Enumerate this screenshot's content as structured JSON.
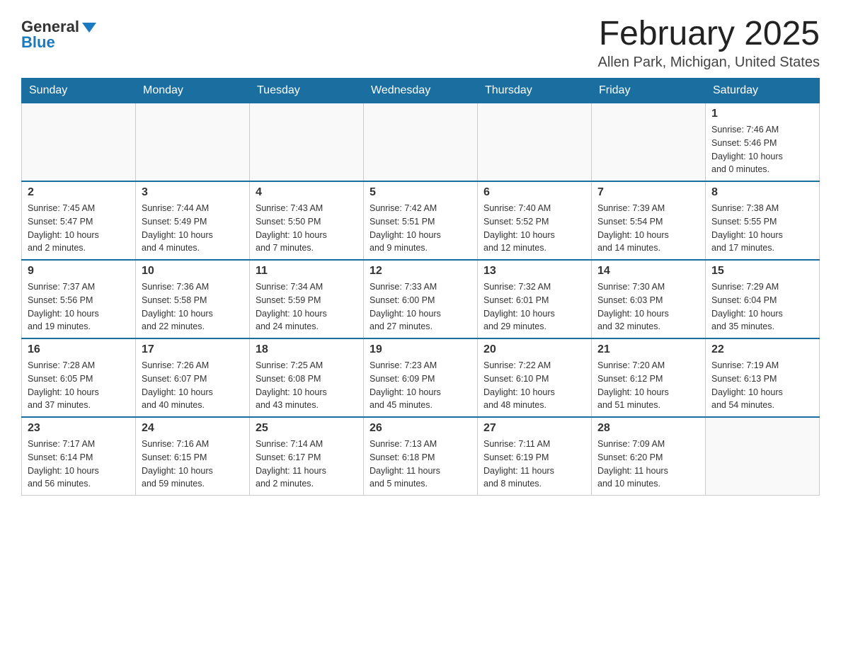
{
  "logo": {
    "general": "General",
    "blue": "Blue"
  },
  "title": "February 2025",
  "location": "Allen Park, Michigan, United States",
  "days_of_week": [
    "Sunday",
    "Monday",
    "Tuesday",
    "Wednesday",
    "Thursday",
    "Friday",
    "Saturday"
  ],
  "weeks": [
    [
      {
        "day": "",
        "info": ""
      },
      {
        "day": "",
        "info": ""
      },
      {
        "day": "",
        "info": ""
      },
      {
        "day": "",
        "info": ""
      },
      {
        "day": "",
        "info": ""
      },
      {
        "day": "",
        "info": ""
      },
      {
        "day": "1",
        "info": "Sunrise: 7:46 AM\nSunset: 5:46 PM\nDaylight: 10 hours\nand 0 minutes."
      }
    ],
    [
      {
        "day": "2",
        "info": "Sunrise: 7:45 AM\nSunset: 5:47 PM\nDaylight: 10 hours\nand 2 minutes."
      },
      {
        "day": "3",
        "info": "Sunrise: 7:44 AM\nSunset: 5:49 PM\nDaylight: 10 hours\nand 4 minutes."
      },
      {
        "day": "4",
        "info": "Sunrise: 7:43 AM\nSunset: 5:50 PM\nDaylight: 10 hours\nand 7 minutes."
      },
      {
        "day": "5",
        "info": "Sunrise: 7:42 AM\nSunset: 5:51 PM\nDaylight: 10 hours\nand 9 minutes."
      },
      {
        "day": "6",
        "info": "Sunrise: 7:40 AM\nSunset: 5:52 PM\nDaylight: 10 hours\nand 12 minutes."
      },
      {
        "day": "7",
        "info": "Sunrise: 7:39 AM\nSunset: 5:54 PM\nDaylight: 10 hours\nand 14 minutes."
      },
      {
        "day": "8",
        "info": "Sunrise: 7:38 AM\nSunset: 5:55 PM\nDaylight: 10 hours\nand 17 minutes."
      }
    ],
    [
      {
        "day": "9",
        "info": "Sunrise: 7:37 AM\nSunset: 5:56 PM\nDaylight: 10 hours\nand 19 minutes."
      },
      {
        "day": "10",
        "info": "Sunrise: 7:36 AM\nSunset: 5:58 PM\nDaylight: 10 hours\nand 22 minutes."
      },
      {
        "day": "11",
        "info": "Sunrise: 7:34 AM\nSunset: 5:59 PM\nDaylight: 10 hours\nand 24 minutes."
      },
      {
        "day": "12",
        "info": "Sunrise: 7:33 AM\nSunset: 6:00 PM\nDaylight: 10 hours\nand 27 minutes."
      },
      {
        "day": "13",
        "info": "Sunrise: 7:32 AM\nSunset: 6:01 PM\nDaylight: 10 hours\nand 29 minutes."
      },
      {
        "day": "14",
        "info": "Sunrise: 7:30 AM\nSunset: 6:03 PM\nDaylight: 10 hours\nand 32 minutes."
      },
      {
        "day": "15",
        "info": "Sunrise: 7:29 AM\nSunset: 6:04 PM\nDaylight: 10 hours\nand 35 minutes."
      }
    ],
    [
      {
        "day": "16",
        "info": "Sunrise: 7:28 AM\nSunset: 6:05 PM\nDaylight: 10 hours\nand 37 minutes."
      },
      {
        "day": "17",
        "info": "Sunrise: 7:26 AM\nSunset: 6:07 PM\nDaylight: 10 hours\nand 40 minutes."
      },
      {
        "day": "18",
        "info": "Sunrise: 7:25 AM\nSunset: 6:08 PM\nDaylight: 10 hours\nand 43 minutes."
      },
      {
        "day": "19",
        "info": "Sunrise: 7:23 AM\nSunset: 6:09 PM\nDaylight: 10 hours\nand 45 minutes."
      },
      {
        "day": "20",
        "info": "Sunrise: 7:22 AM\nSunset: 6:10 PM\nDaylight: 10 hours\nand 48 minutes."
      },
      {
        "day": "21",
        "info": "Sunrise: 7:20 AM\nSunset: 6:12 PM\nDaylight: 10 hours\nand 51 minutes."
      },
      {
        "day": "22",
        "info": "Sunrise: 7:19 AM\nSunset: 6:13 PM\nDaylight: 10 hours\nand 54 minutes."
      }
    ],
    [
      {
        "day": "23",
        "info": "Sunrise: 7:17 AM\nSunset: 6:14 PM\nDaylight: 10 hours\nand 56 minutes."
      },
      {
        "day": "24",
        "info": "Sunrise: 7:16 AM\nSunset: 6:15 PM\nDaylight: 10 hours\nand 59 minutes."
      },
      {
        "day": "25",
        "info": "Sunrise: 7:14 AM\nSunset: 6:17 PM\nDaylight: 11 hours\nand 2 minutes."
      },
      {
        "day": "26",
        "info": "Sunrise: 7:13 AM\nSunset: 6:18 PM\nDaylight: 11 hours\nand 5 minutes."
      },
      {
        "day": "27",
        "info": "Sunrise: 7:11 AM\nSunset: 6:19 PM\nDaylight: 11 hours\nand 8 minutes."
      },
      {
        "day": "28",
        "info": "Sunrise: 7:09 AM\nSunset: 6:20 PM\nDaylight: 11 hours\nand 10 minutes."
      },
      {
        "day": "",
        "info": ""
      }
    ]
  ]
}
